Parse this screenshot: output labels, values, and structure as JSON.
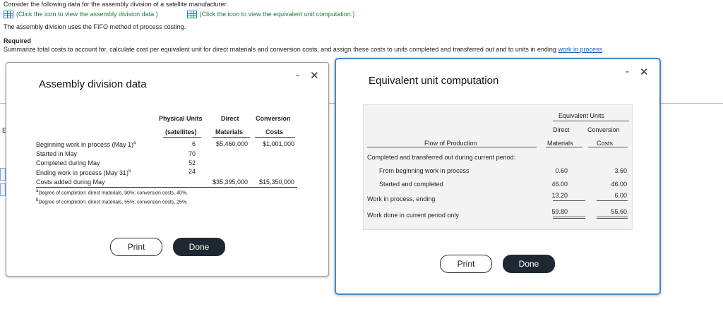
{
  "background": {
    "line1": "Consider the following data for the assembly division of a satellite manufacturer:",
    "link1": "(Click the icon to view the assembly division data.)",
    "link2": "(Click the icon to view the equivalent unit computation.)",
    "line3": "The assembly division uses the FIFO method of process costing.",
    "required": "Required",
    "instruction": "Summarize total costs to account for, calculate cost per equivalent unit for direct materials and conversion costs, and assign these costs to units completed and transferred out and to units in ending",
    "instruction_link": "work in process",
    "instruction_end": ".",
    "edge_char": "E"
  },
  "window1": {
    "title": "Assembly division data",
    "minimize": "-",
    "close": "✕",
    "headers": {
      "physical_1": "Physical Units",
      "physical_2": "(satellites)",
      "dm_1": "Direct",
      "dm_2": "Materials",
      "conv_1": "Conversion",
      "conv_2": "Costs"
    },
    "rows": [
      {
        "label": "Beginning work in process (May 1)",
        "sup": "a",
        "units": "6",
        "dm": "$5,460,000",
        "conv": "$1,001,000"
      },
      {
        "label": "Started in May",
        "units": "70"
      },
      {
        "label": "Completed during May",
        "units": "52"
      },
      {
        "label": "Ending work in process (May 31)",
        "sup": "b",
        "units": "24"
      },
      {
        "label": "Costs added during May",
        "dm": "$35,395,000",
        "conv": "$15,350,000"
      }
    ],
    "footnote_a_mark": "a",
    "footnote_a": "Degree of completion: direct materials, 90%; conversion costs, 40%.",
    "footnote_b_mark": "b",
    "footnote_b": "Degree of completion: direct materials, 55%; conversion costs, 25%.",
    "print": "Print",
    "done": "Done"
  },
  "window2": {
    "title": "Equivalent unit computation",
    "minimize": "-",
    "close": "✕",
    "header_group": "Equivalent Units",
    "col_dm_1": "Direct",
    "col_dm_2": "Materials",
    "col_conv_1": "Conversion",
    "col_conv_2": "Costs",
    "flow_header": "Flow of Production",
    "section1": "Completed and transferred out during current period:",
    "rows": [
      {
        "label": "From beginning work in process",
        "dm": "0.60",
        "conv": "3.60"
      },
      {
        "label": "Started and completed",
        "dm": "46.00",
        "conv": "46.00"
      },
      {
        "label": "Work in process, ending",
        "dm": "13.20",
        "conv": "6.00"
      },
      {
        "label": "Work done in current period only",
        "dm": "59.80",
        "conv": "55.60"
      }
    ],
    "print": "Print",
    "done": "Done"
  }
}
